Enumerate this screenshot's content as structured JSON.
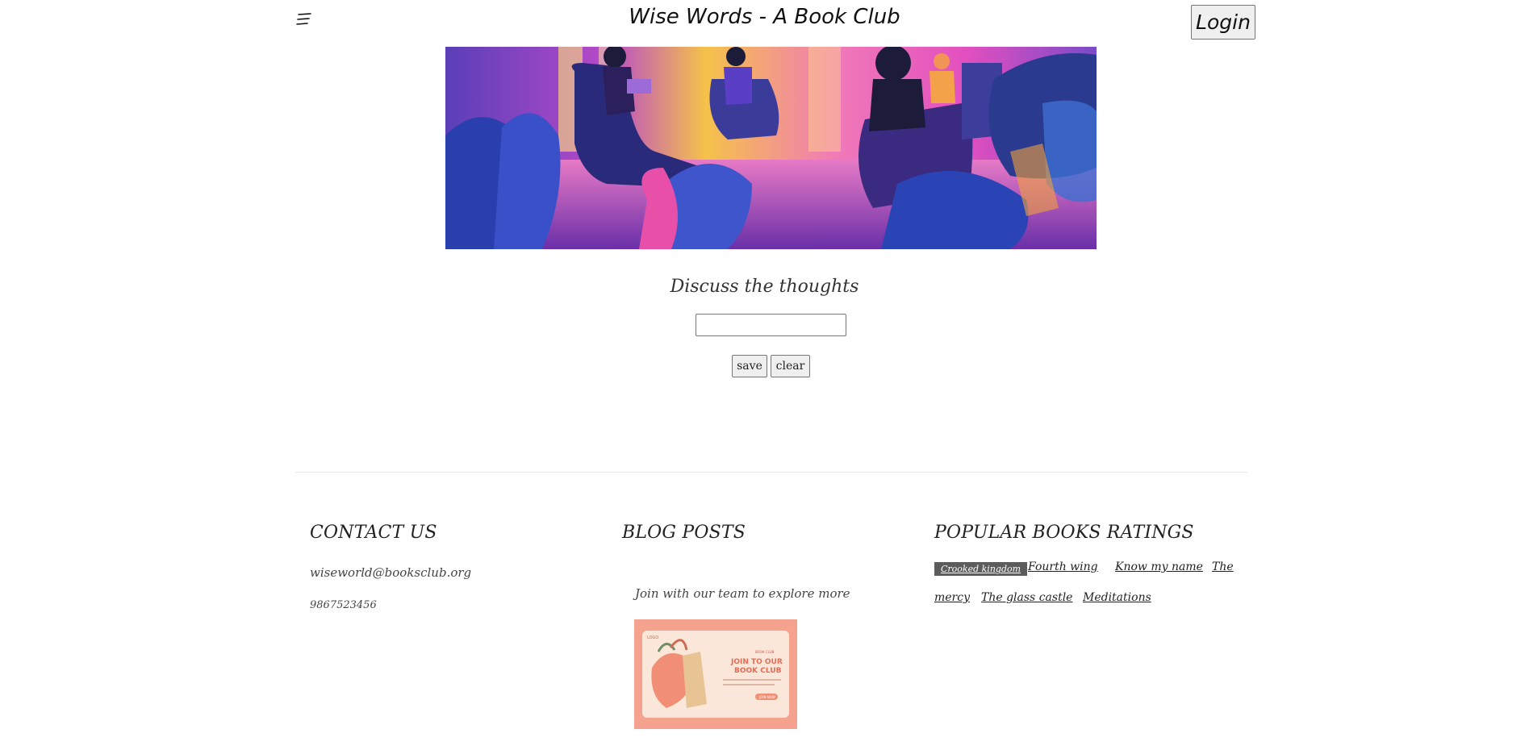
{
  "header": {
    "title": "Wise Words - A Book Club",
    "login_label": "Login",
    "menu_icon": "hamburger-menu-icon"
  },
  "hero": {
    "image": "book-club-illustration"
  },
  "discuss": {
    "heading": "Discuss the thoughts",
    "input_value": "",
    "save_label": "save",
    "clear_label": "clear"
  },
  "footer": {
    "contact": {
      "heading": "CONTACT US",
      "email": "wiseworld@booksclub.org",
      "phone": "9867523456"
    },
    "blog": {
      "heading": "BLOG POSTS",
      "text": "Join with our team to explore more",
      "thumbnail": {
        "logo": "LOGO",
        "badge": "BOOK CLUB",
        "headline_1": "JOIN TO OUR",
        "headline_2": "BOOK CLUB",
        "button": "JOIN NOW"
      }
    },
    "popular": {
      "heading": "POPULAR BOOKS RATINGS",
      "tags": [
        "Crooked kingdom",
        "Fourth wing",
        "Know my name",
        "The",
        "mercy",
        "The glass castle",
        "Meditations"
      ]
    }
  },
  "colors": {
    "active_tag_bg": "#5c5c5c",
    "thumb_bg": "#f5a38f"
  }
}
